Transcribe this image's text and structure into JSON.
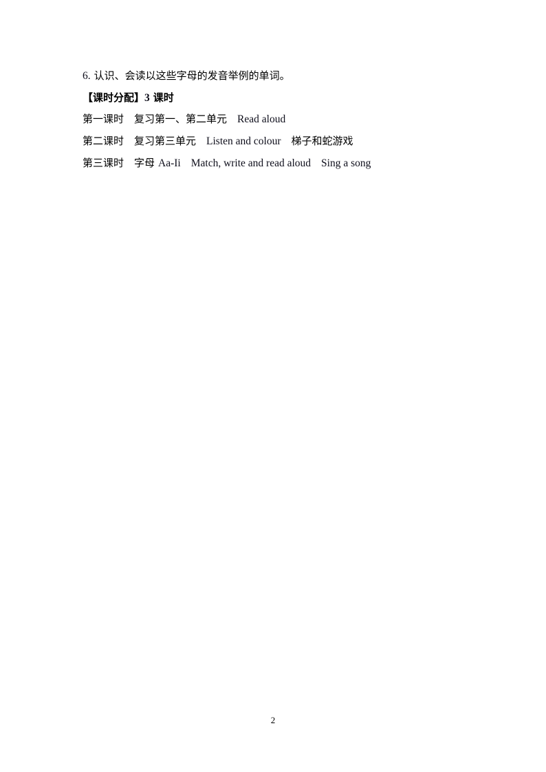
{
  "document": {
    "item6": {
      "number": "6.",
      "text": "认识、会读以这些字母的发音举例的单词。"
    },
    "allocation": {
      "heading": "【课时分配】",
      "count": "3",
      "unit": "课时"
    },
    "lessons": [
      {
        "label": "第一课时",
        "parts": [
          "复习第一、第二单元",
          "Read aloud"
        ]
      },
      {
        "label": "第二课时",
        "parts": [
          "复习第三单元",
          "Listen and colour",
          "梯子和蛇游戏"
        ]
      },
      {
        "label": "第三课时",
        "parts": [
          "字母",
          "Aa-Ii",
          "Match, write and read aloud",
          "Sing a song"
        ]
      }
    ],
    "page_number": "2"
  }
}
